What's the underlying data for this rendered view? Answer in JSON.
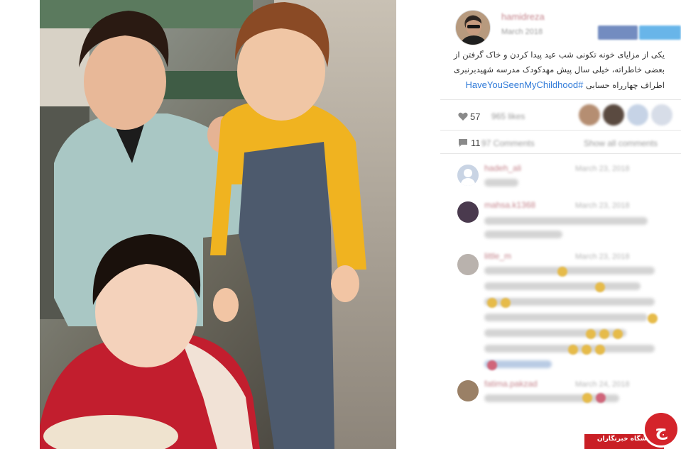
{
  "post": {
    "author": "hamidreza",
    "date": "March 2018",
    "caption_lines": [
      "یکی از مزایای خونه تکونی شب عید پیدا کردن و خاک گرفتن از",
      "بعضی خاطراته، خیلی سال پیش مهدکودک مدرسه شهیدبرنبری",
      "اطراف چهارراه حسابی"
    ],
    "hashtag": "#HaveYouSeenMyChildhood"
  },
  "stats": {
    "likes_visible": "57",
    "likes_blurred": "965 likes",
    "comments_visible": "11",
    "comments_blurred": "97 Comments",
    "show_all_blurred": "Show all comments"
  },
  "comments": [
    {
      "name": "hadeh_ali",
      "time": "March 23, 2018"
    },
    {
      "name": "mahsa.k1368",
      "time": "March 23, 2018"
    },
    {
      "name": "little_m",
      "time": "March 23, 2018"
    },
    {
      "name": "fatima.pakzad",
      "time": "March 24, 2018"
    }
  ],
  "watermark": {
    "banner_text": "باشگاه خبرنگاران",
    "logo_glyph": "ج",
    "banner_color": "#c91f25"
  },
  "icons": {
    "like": "heart-icon",
    "comment": "speech-bubble-icon"
  }
}
